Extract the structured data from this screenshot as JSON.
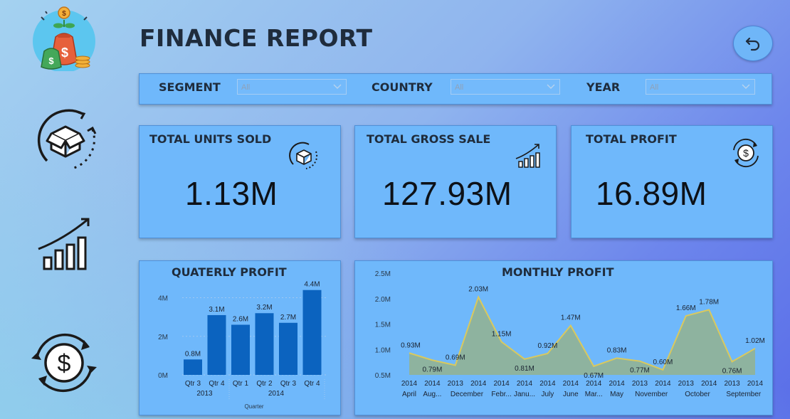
{
  "header": {
    "title": "FINANCE REPORT"
  },
  "filters": [
    {
      "label": "SEGMENT",
      "value": "All"
    },
    {
      "label": "COUNTRY",
      "value": "All"
    },
    {
      "label": "YEAR",
      "value": "All"
    }
  ],
  "kpis": [
    {
      "title": "TOTAL UNITS SOLD",
      "value": "1.13M",
      "icon": "box-cycle-icon"
    },
    {
      "title": "TOTAL GROSS SALE",
      "value": "127.93M",
      "icon": "growth-bars-icon"
    },
    {
      "title": "TOTAL PROFIT",
      "value": "16.89M",
      "icon": "dollar-cycle-icon"
    }
  ],
  "sidebar_icons": [
    "money-bag-logo-icon",
    "box-cycle-icon",
    "growth-bars-icon",
    "dollar-cycle-icon"
  ],
  "chart_data": [
    {
      "type": "bar",
      "title": "QUATERLY PROFIT",
      "xlabel": "Quarter",
      "ylabel": "",
      "categories": [
        "Qtr 3",
        "Qtr 4",
        "Qtr 1",
        "Qtr 2",
        "Qtr 3",
        "Qtr 4"
      ],
      "groups": [
        {
          "label": "2013",
          "count": 2
        },
        {
          "label": "2014",
          "count": 4
        }
      ],
      "values": [
        0.8,
        3.1,
        2.6,
        3.2,
        2.7,
        4.4
      ],
      "labels": [
        "0.8M",
        "3.1M",
        "2.6M",
        "3.2M",
        "2.7M",
        "4.4M"
      ],
      "yticks": [
        "0M",
        "2M",
        "4M"
      ],
      "ylim": [
        0,
        4.5
      ],
      "color": "#0b63bf"
    },
    {
      "type": "area",
      "title": "MONTHLY PROFIT",
      "x_years": [
        "2014",
        "2014",
        "2013",
        "2014",
        "2014",
        "2014",
        "2014",
        "2014",
        "2014",
        "2014",
        "2013",
        "2014",
        "2013",
        "2014",
        "2013",
        "2014"
      ],
      "x_months": [
        "April",
        "Aug...",
        "December",
        "Febr...",
        "Janu...",
        "July",
        "June",
        "Mar...",
        "May",
        "November",
        "",
        "",
        "October",
        "",
        "September",
        ""
      ],
      "month_labels": [
        {
          "text": "April",
          "col": 0
        },
        {
          "text": "Aug...",
          "col": 1
        },
        {
          "text": "December",
          "col": 2.5
        },
        {
          "text": "Febr...",
          "col": 4
        },
        {
          "text": "Janu...",
          "col": 5
        },
        {
          "text": "July",
          "col": 6
        },
        {
          "text": "June",
          "col": 7
        },
        {
          "text": "Mar...",
          "col": 8
        },
        {
          "text": "May",
          "col": 9
        },
        {
          "text": "November",
          "col": 10.5
        },
        {
          "text": "October",
          "col": 12.5
        },
        {
          "text": "September",
          "col": 14.5
        }
      ],
      "values": [
        0.93,
        0.79,
        0.69,
        2.03,
        1.15,
        0.81,
        0.92,
        1.47,
        0.67,
        0.83,
        0.77,
        0.6,
        1.66,
        1.78,
        0.76,
        1.02
      ],
      "labels": [
        "0.93M",
        "0.79M",
        "0.69M",
        "2.03M",
        "1.15M",
        "0.81M",
        "0.92M",
        "1.47M",
        "0.67M",
        "0.83M",
        "0.77M",
        "0.60M",
        "1.66M",
        "1.78M",
        "0.76M",
        "1.02M"
      ],
      "yticks": [
        "0.5M",
        "1.0M",
        "1.5M",
        "2.0M",
        "2.5M"
      ],
      "ylim": [
        0.5,
        2.5
      ],
      "line_color": "#d9c95e",
      "fill_color": "#8fb29a"
    }
  ]
}
